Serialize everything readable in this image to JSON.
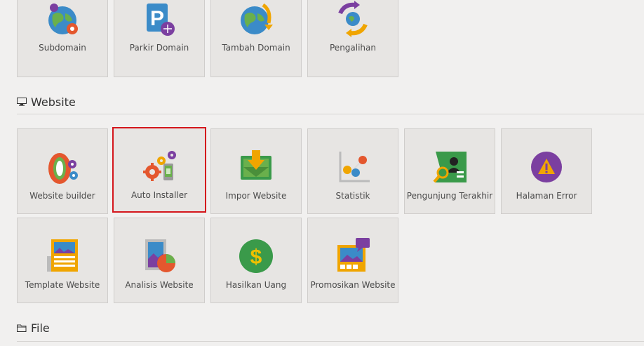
{
  "domains": {
    "items": [
      {
        "label": "Subdomain",
        "icon": "subdomain-icon"
      },
      {
        "label": "Parkir Domain",
        "icon": "parked-domain-icon"
      },
      {
        "label": "Tambah Domain",
        "icon": "add-domain-icon"
      },
      {
        "label": "Pengalihan",
        "icon": "redirect-icon"
      }
    ]
  },
  "website": {
    "title": "Website",
    "title_icon": "monitor-icon",
    "items": [
      {
        "label": "Website builder",
        "icon": "website-builder-icon"
      },
      {
        "label": "Auto Installer",
        "icon": "auto-installer-icon",
        "selected": true
      },
      {
        "label": "Impor Website",
        "icon": "import-website-icon"
      },
      {
        "label": "Statistik",
        "icon": "statistics-icon"
      },
      {
        "label": "Pengunjung Terakhir",
        "icon": "last-visitors-icon"
      },
      {
        "label": "Halaman Error",
        "icon": "error-page-icon"
      },
      {
        "label": "Template Website",
        "icon": "template-website-icon"
      },
      {
        "label": "Analisis Website",
        "icon": "website-analysis-icon"
      },
      {
        "label": "Hasilkan Uang",
        "icon": "make-money-icon"
      },
      {
        "label": "Promosikan Website",
        "icon": "promote-website-icon"
      }
    ]
  },
  "file": {
    "title": "File",
    "title_icon": "folder-icon"
  },
  "colors": {
    "selected_border": "#d4161c",
    "tile_bg": "#e7e5e3",
    "page_bg": "#f1f0ef"
  }
}
